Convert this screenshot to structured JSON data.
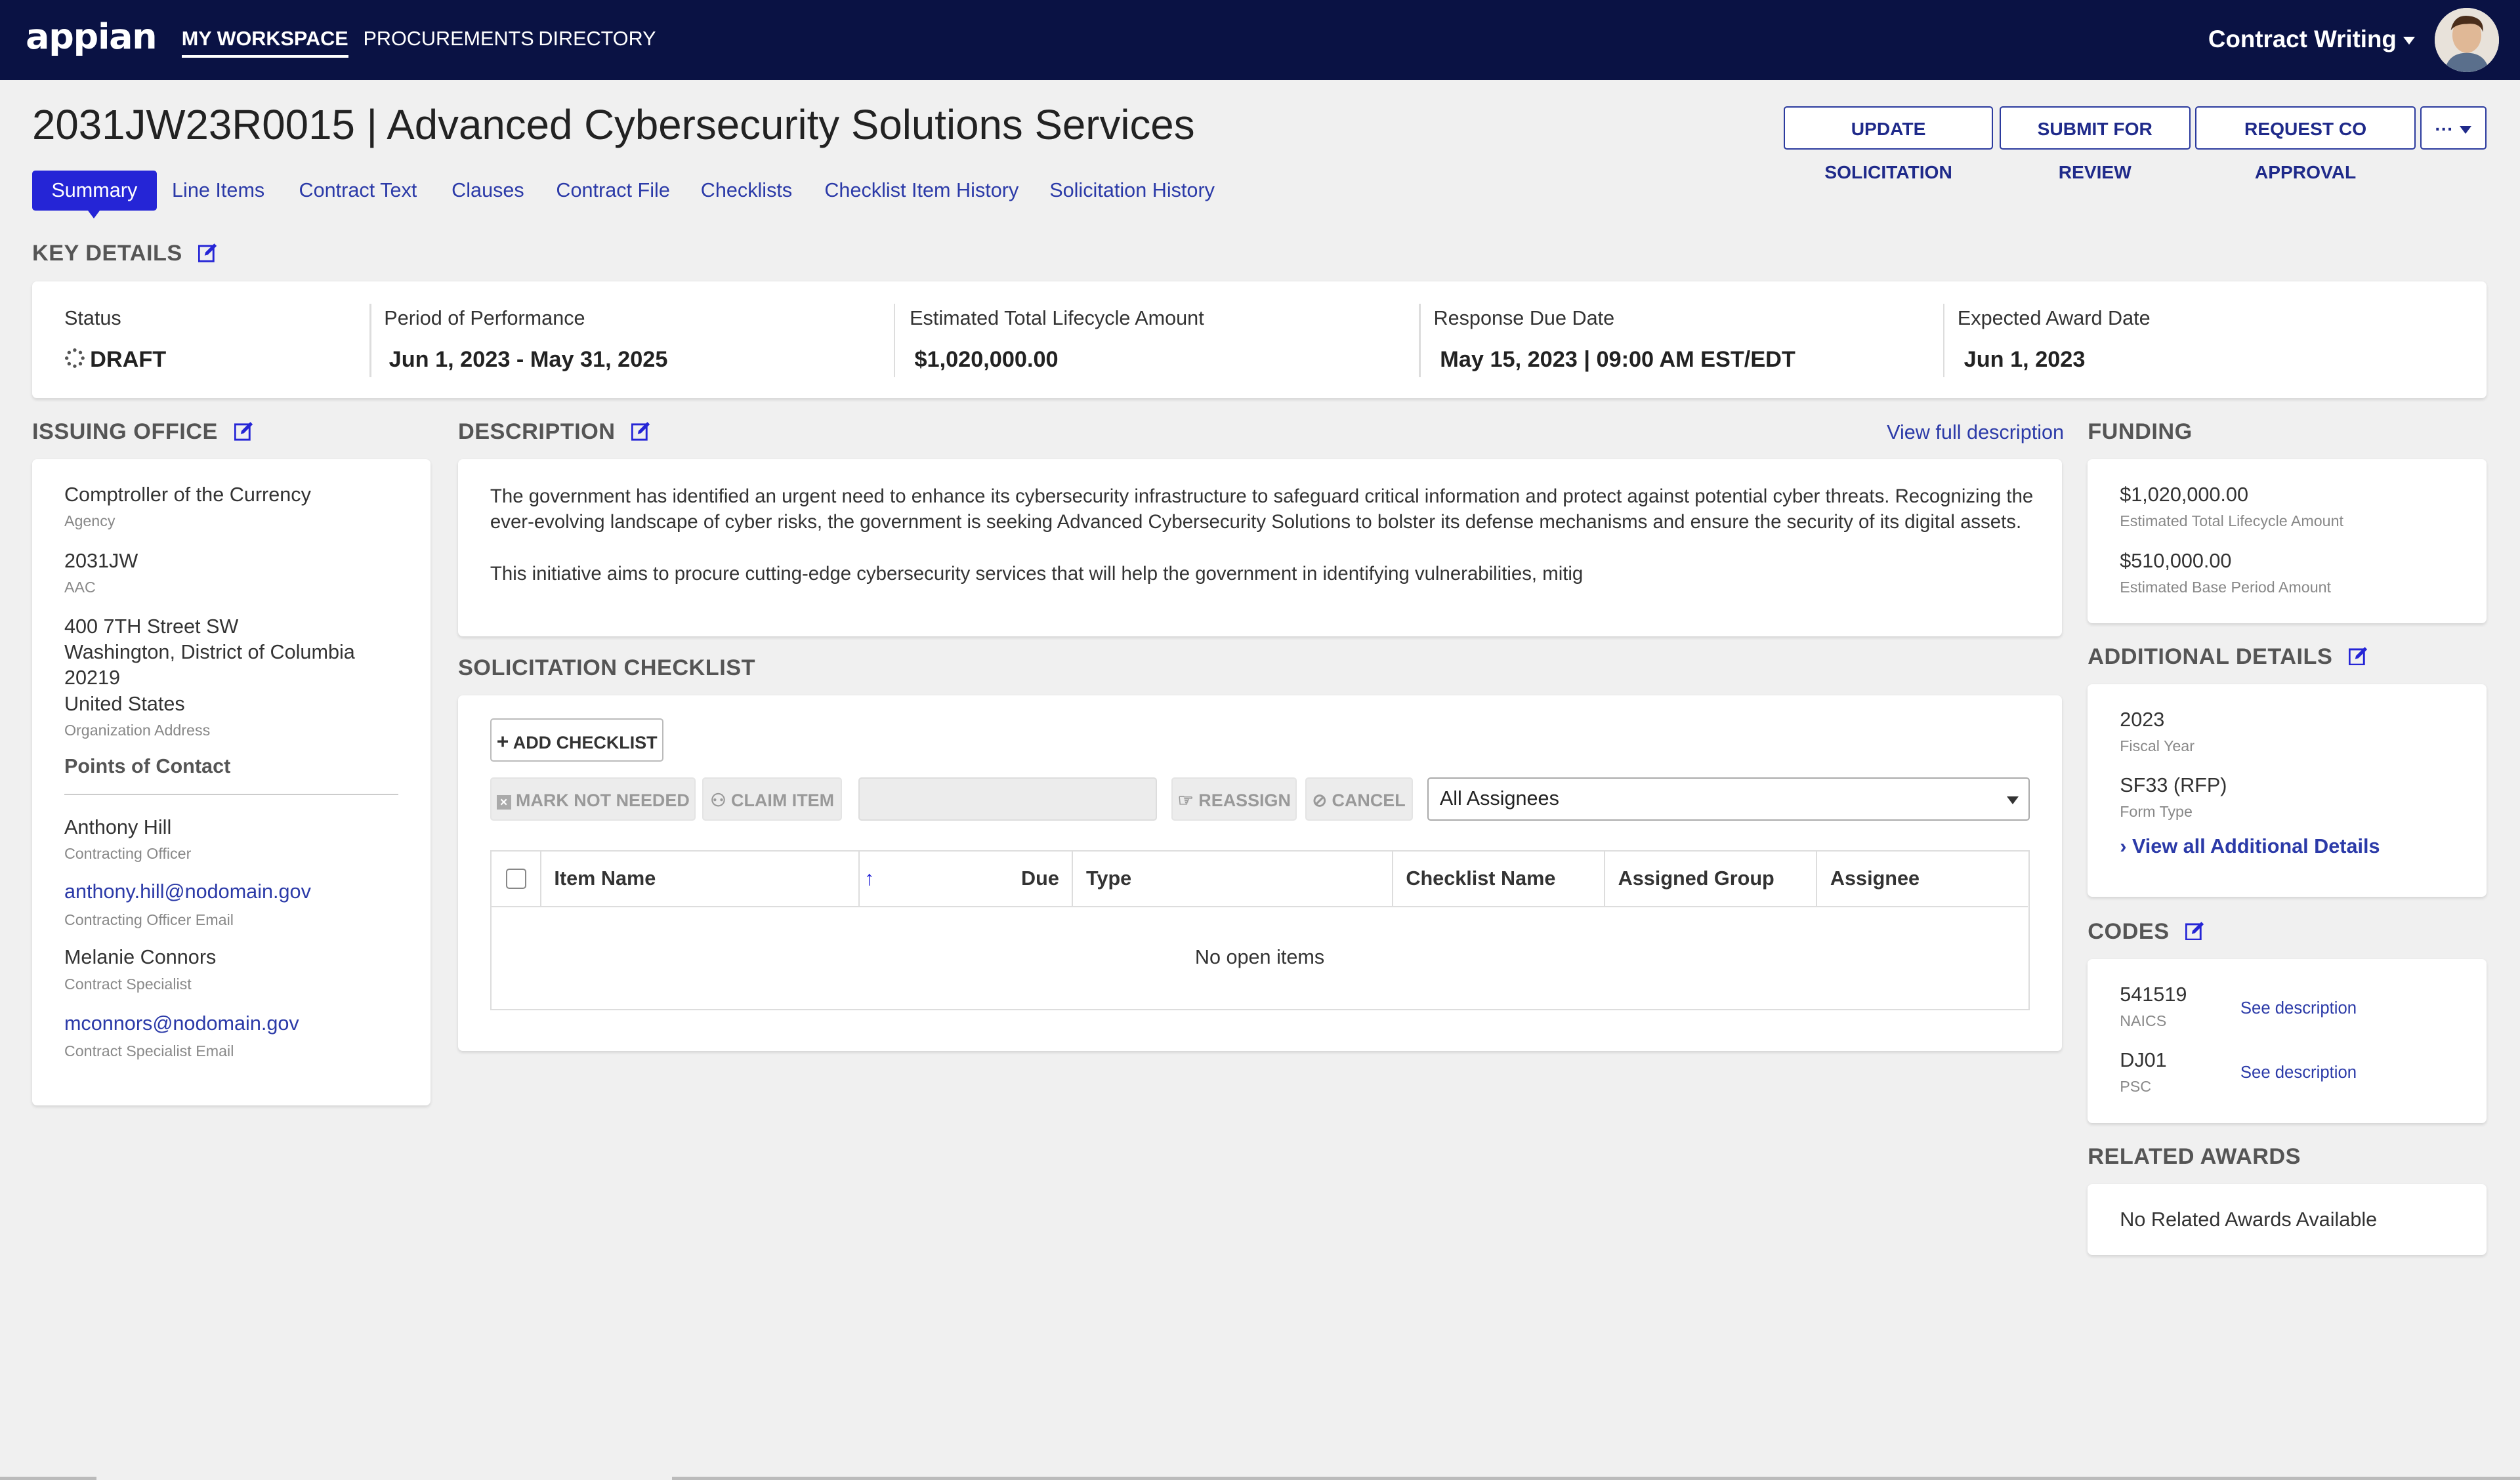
{
  "nav": {
    "logo": "appian",
    "items": [
      "MY WORKSPACE",
      "PROCUREMENTS",
      "DIRECTORY"
    ],
    "app_name": "Contract Writing"
  },
  "header": {
    "title": "2031JW23R0015 | Advanced Cybersecurity Solutions Services",
    "actions": [
      "UPDATE SOLICITATION",
      "SUBMIT FOR REVIEW",
      "REQUEST CO APPROVAL"
    ],
    "more": "···"
  },
  "tabs": [
    "Summary",
    "Line Items",
    "Contract Text",
    "Clauses",
    "Contract File",
    "Checklists",
    "Checklist Item History",
    "Solicitation History"
  ],
  "key_details": {
    "heading": "KEY DETAILS",
    "items": [
      {
        "label": "Status",
        "value": "DRAFT"
      },
      {
        "label": "Period of Performance",
        "value": "Jun 1, 2023 - May 31, 2025"
      },
      {
        "label": "Estimated Total Lifecycle Amount",
        "value": "$1,020,000.00"
      },
      {
        "label": "Response Due Date",
        "value": "May 15, 2023 | 09:00 AM EST/EDT"
      },
      {
        "label": "Expected Award Date",
        "value": "Jun 1, 2023"
      }
    ]
  },
  "issuing_office": {
    "heading": "ISSUING OFFICE",
    "agency": "Comptroller of the Currency",
    "agency_label": "Agency",
    "aac": "2031JW",
    "aac_label": "AAC",
    "address_line1": "400 7TH Street SW",
    "address_line2": "Washington, District of Columbia",
    "address_line3": "20219",
    "address_line4": "United States",
    "address_label": "Organization Address",
    "poc_heading": "Points of Contact",
    "contacts": [
      {
        "name": "Anthony Hill",
        "role": "Contracting Officer",
        "email": "anthony.hill@nodomain.gov",
        "email_label": "Contracting Officer Email"
      },
      {
        "name": "Melanie Connors",
        "role": "Contract Specialist",
        "email": "mconnors@nodomain.gov",
        "email_label": "Contract Specialist Email"
      }
    ]
  },
  "description": {
    "heading": "DESCRIPTION",
    "view_full": "View full description",
    "para1": "The government has identified an urgent need to enhance its cybersecurity infrastructure to safeguard critical information and protect against potential cyber threats. Recognizing the ever-evolving landscape of cyber risks, the government is seeking Advanced Cybersecurity Solutions to bolster its defense mechanisms and ensure the security of its digital assets.",
    "para2": "This initiative aims to procure cutting-edge cybersecurity services that will help the government in identifying vulnerabilities, mitig"
  },
  "checklist": {
    "heading": "SOLICITATION CHECKLIST",
    "add_button": "ADD CHECKLIST",
    "mark_not_needed": "MARK NOT NEEDED",
    "claim_item": "CLAIM ITEM",
    "reassign": "REASSIGN",
    "cancel": "CANCEL",
    "assignee_select": "All Assignees",
    "columns": [
      "Item Name",
      "Due",
      "Type",
      "Checklist Name",
      "Assigned Group",
      "Assignee"
    ],
    "empty_text": "No open items"
  },
  "funding": {
    "heading": "FUNDING",
    "items": [
      {
        "value": "$1,020,000.00",
        "label": "Estimated Total Lifecycle Amount"
      },
      {
        "value": "$510,000.00",
        "label": "Estimated Base Period Amount"
      }
    ]
  },
  "additional_details": {
    "heading": "ADDITIONAL DETAILS",
    "items": [
      {
        "value": "2023",
        "label": "Fiscal Year"
      },
      {
        "value": "SF33 (RFP)",
        "label": "Form Type"
      }
    ],
    "view_all": "View all Additional Details"
  },
  "codes": {
    "heading": "CODES",
    "items": [
      {
        "value": "541519",
        "label": "NAICS",
        "link": "See description"
      },
      {
        "value": "DJ01",
        "label": "PSC",
        "link": "See description"
      }
    ]
  },
  "related_awards": {
    "heading": "RELATED AWARDS",
    "empty_text": "No Related Awards Available"
  },
  "colors": {
    "nav_bg": "#0a1244",
    "accent": "#2525d6",
    "link": "#2b3aa8",
    "page_bg": "#f0f0f0"
  }
}
